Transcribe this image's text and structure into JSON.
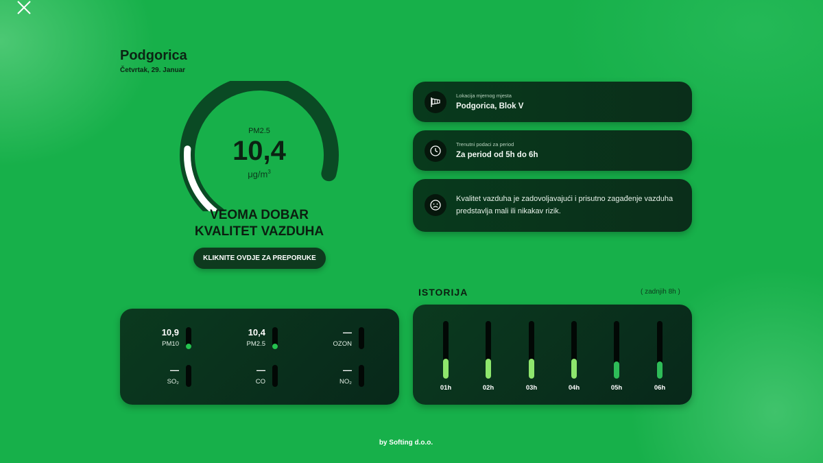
{
  "header": {
    "city": "Podgorica",
    "date": "Četvrtak, 29. Januar"
  },
  "gauge": {
    "pollutant": "PM2.5",
    "value": "10,4",
    "unit": "μg/m",
    "unit_sup": "3",
    "level_fraction": 0.23,
    "color": "#ffffff",
    "track_color": "#0a4a24"
  },
  "quality": {
    "line1": "VEOMA DOBAR",
    "line2": "KVALITET VAZDUHA"
  },
  "recommendations_button": "KLIKNITE OVDJE ZA PREPORUKE",
  "info_cards": [
    {
      "icon": "windsock-icon",
      "label": "Lokacija mjernog mjesta",
      "value": "Podgorica, Blok V"
    },
    {
      "icon": "clock-icon",
      "label": "Trenutni podaci za period",
      "value": "Za period od 5h do 6h"
    },
    {
      "icon": "face-icon",
      "description": "Kvalitet vazduha je zadovoljavajući i prisutno zagađenje vazduha predstavlja mali ili nikakav rizik."
    }
  ],
  "pollutants": [
    {
      "value": "10,9",
      "name": "PM10",
      "level": 0.1
    },
    {
      "value": "10,4",
      "name": "PM2.5",
      "level": 0.1
    },
    {
      "value": "—",
      "name": "OZON",
      "level": 0
    },
    {
      "value": "—",
      "name": "SO₂",
      "level": 0
    },
    {
      "value": "—",
      "name": "CO",
      "level": 0
    },
    {
      "value": "—",
      "name": "NO₂",
      "level": 0
    }
  ],
  "history": {
    "title": "ISTORIJA",
    "subtitle": "( zadnjih 8h )",
    "bars": [
      {
        "hour": "01h",
        "level": 0.35,
        "color": "#8ee66d"
      },
      {
        "hour": "02h",
        "level": 0.35,
        "color": "#8ee66d"
      },
      {
        "hour": "03h",
        "level": 0.35,
        "color": "#8ee66d"
      },
      {
        "hour": "04h",
        "level": 0.35,
        "color": "#8ee66d"
      },
      {
        "hour": "05h",
        "level": 0.3,
        "color": "#2ebc58"
      },
      {
        "hour": "06h",
        "level": 0.3,
        "color": "#2ebc58"
      }
    ]
  },
  "footer": "by Softing d.o.o."
}
